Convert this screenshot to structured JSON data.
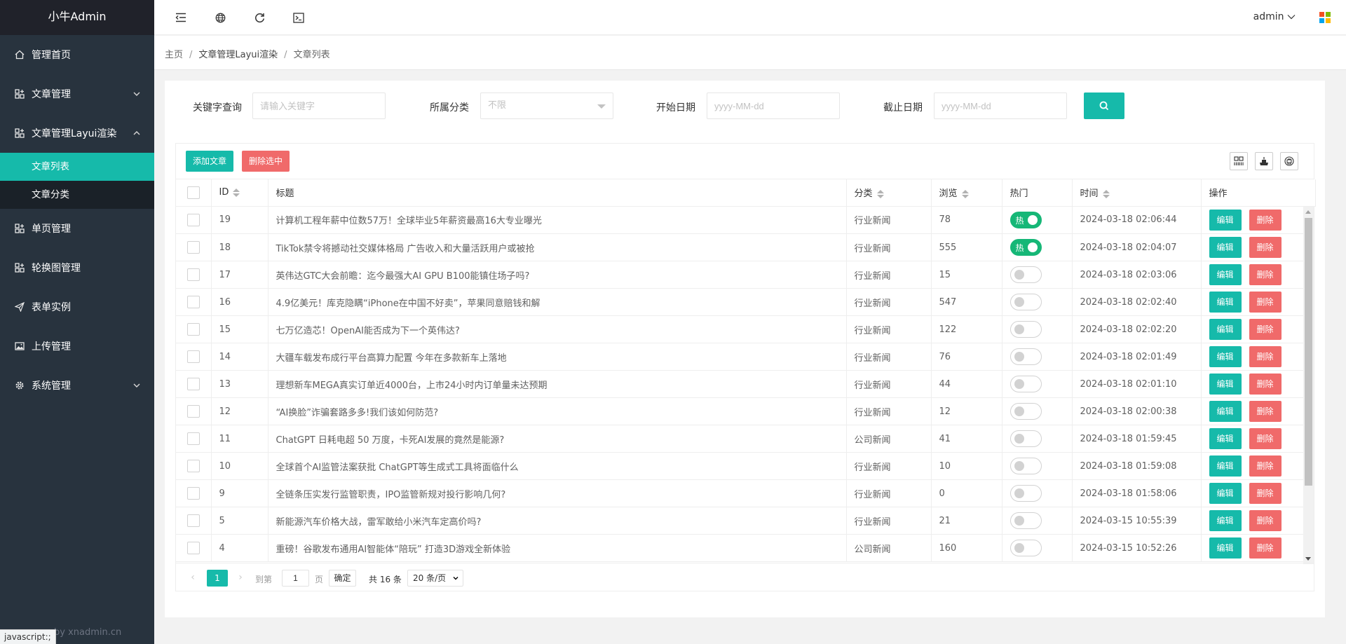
{
  "sidebar": {
    "logo": "小牛Admin",
    "items": [
      {
        "label": "管理首页",
        "icon": "home-icon"
      },
      {
        "label": "文章管理",
        "icon": "grid-add-icon"
      },
      {
        "label": "文章管理Layui渲染",
        "icon": "grid-add-icon"
      },
      {
        "label": "单页管理",
        "icon": "grid-add-icon"
      },
      {
        "label": "轮换图管理",
        "icon": "grid-add-icon"
      },
      {
        "label": "表单实例",
        "icon": "paper-plane-icon"
      },
      {
        "label": "上传管理",
        "icon": "image-icon"
      },
      {
        "label": "系统管理",
        "icon": "gear-icon"
      }
    ],
    "sub_items": [
      {
        "label": "文章列表",
        "active": true
      },
      {
        "label": "文章分类",
        "active": false
      }
    ],
    "status_tip": "javascript:;",
    "footer": "by xnadmin.cn"
  },
  "header": {
    "user": "admin",
    "icons": [
      "menu-fold-icon",
      "globe-icon",
      "refresh-icon",
      "terminal-icon"
    ],
    "apps_colors": [
      "#f25022",
      "#7fba00",
      "#00a4ef",
      "#ffb900"
    ]
  },
  "breadcrumb": [
    "主页",
    "文章管理Layui渲染",
    "文章列表"
  ],
  "search": {
    "keyword_label": "关键字查询",
    "keyword_placeholder": "请输入关键字",
    "category_label": "所属分类",
    "category_value": "不限",
    "start_label": "开始日期",
    "start_placeholder": "yyyy-MM-dd",
    "end_label": "截止日期",
    "end_placeholder": "yyyy-MM-dd"
  },
  "toolbar": {
    "add_label": "添加文章",
    "delete_selected_label": "删除选中"
  },
  "table": {
    "columns": [
      "ID",
      "标题",
      "分类",
      "浏览",
      "热门",
      "时间",
      "操作"
    ],
    "hot_label": "热",
    "edit_label": "编辑",
    "delete_label": "删除",
    "rows": [
      {
        "id": "19",
        "title": "计算机工程年薪中位数57万！全球毕业5年薪资最高16大专业曝光",
        "category": "行业新闻",
        "views": "78",
        "hot": true,
        "time": "2024-03-18 02:06:44"
      },
      {
        "id": "18",
        "title": "TikTok禁令将撼动社交媒体格局 广告收入和大量活跃用户或被抢",
        "category": "行业新闻",
        "views": "555",
        "hot": true,
        "time": "2024-03-18 02:04:07"
      },
      {
        "id": "17",
        "title": "英伟达GTC大会前瞻：迄今最强大AI GPU B100能镇住场子吗?",
        "category": "行业新闻",
        "views": "15",
        "hot": false,
        "time": "2024-03-18 02:03:06"
      },
      {
        "id": "16",
        "title": "4.9亿美元！库克隐瞒“iPhone在中国不好卖”，苹果同意赔钱和解",
        "category": "行业新闻",
        "views": "547",
        "hot": false,
        "time": "2024-03-18 02:02:40"
      },
      {
        "id": "15",
        "title": "七万亿造芯！OpenAI能否成为下一个英伟达?",
        "category": "行业新闻",
        "views": "122",
        "hot": false,
        "time": "2024-03-18 02:02:20"
      },
      {
        "id": "14",
        "title": "大疆车载发布成行平台高算力配置 今年在多款新车上落地",
        "category": "行业新闻",
        "views": "76",
        "hot": false,
        "time": "2024-03-18 02:01:49"
      },
      {
        "id": "13",
        "title": "理想新车MEGA真实订单近4000台，上市24小时内订单量未达预期",
        "category": "行业新闻",
        "views": "44",
        "hot": false,
        "time": "2024-03-18 02:01:10"
      },
      {
        "id": "12",
        "title": "“AI换脸”诈骗套路多多!我们该如何防范?",
        "category": "行业新闻",
        "views": "12",
        "hot": false,
        "time": "2024-03-18 02:00:38"
      },
      {
        "id": "11",
        "title": "ChatGPT 日耗电超 50 万度，卡死AI发展的竟然是能源?",
        "category": "公司新闻",
        "views": "41",
        "hot": false,
        "time": "2024-03-18 01:59:45"
      },
      {
        "id": "10",
        "title": "全球首个AI监管法案获批 ChatGPT等生成式工具将面临什么",
        "category": "行业新闻",
        "views": "10",
        "hot": false,
        "time": "2024-03-18 01:59:08"
      },
      {
        "id": "9",
        "title": "全链条压实发行监管职责，IPO监管新规对投行影响几何?",
        "category": "行业新闻",
        "views": "0",
        "hot": false,
        "time": "2024-03-18 01:58:06"
      },
      {
        "id": "5",
        "title": "新能源汽车价格大战，雷军敢给小米汽车定高价吗?",
        "category": "行业新闻",
        "views": "21",
        "hot": false,
        "time": "2024-03-15 10:55:39"
      },
      {
        "id": "4",
        "title": "重磅！谷歌发布通用AI智能体“陪玩” 打造3D游戏全新体验",
        "category": "公司新闻",
        "views": "160",
        "hot": false,
        "time": "2024-03-15 10:52:26"
      }
    ]
  },
  "pager": {
    "current": "1",
    "goto_label": "到第",
    "page_input": "1",
    "page_unit": "页",
    "ok_label": "确定",
    "total": "共 16 条",
    "page_size": "20 条/页"
  }
}
